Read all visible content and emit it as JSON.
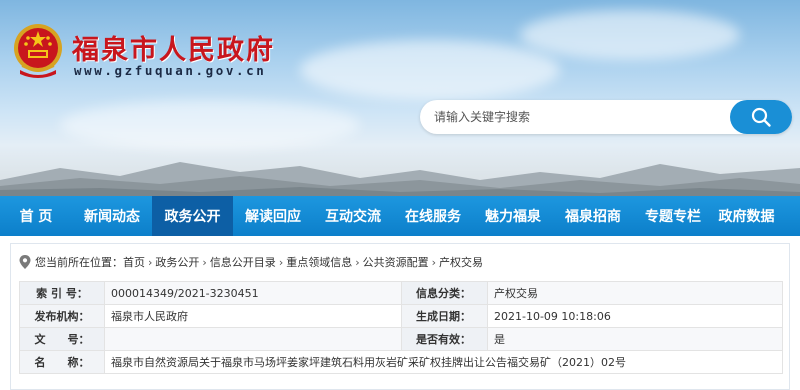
{
  "site": {
    "title": "福泉市人民政府",
    "url": "www.gzfuquan.gov.cn"
  },
  "search": {
    "placeholder": "请输入关键字搜索",
    "button_icon": "search-icon"
  },
  "nav": {
    "items": [
      {
        "label": "首 页"
      },
      {
        "label": "新闻动态"
      },
      {
        "label": "政务公开",
        "active": true
      },
      {
        "label": "解读回应"
      },
      {
        "label": "互动交流"
      },
      {
        "label": "在线服务"
      },
      {
        "label": "魅力福泉"
      },
      {
        "label": "福泉招商"
      },
      {
        "label": "专题专栏"
      },
      {
        "label": "政府数据"
      }
    ]
  },
  "breadcrumb": {
    "prefix": "您当前所在位置：",
    "items": [
      "首页",
      "政务公开",
      "信息公开目录",
      "重点领域信息",
      "公共资源配置",
      "产权交易"
    ],
    "separator": "›"
  },
  "info": {
    "index_label": "索 引 号：",
    "index_value": "000014349/2021-3230451",
    "category_label": "信息分类：",
    "category_value": "产权交易",
    "org_label": "发布机构：",
    "org_value": "福泉市人民政府",
    "date_label": "生成日期：",
    "date_value": "2021-10-09 10:18:06",
    "docno_label": "文　　号：",
    "docno_value": "",
    "valid_label": "是否有效：",
    "valid_value": "是",
    "name_label": "名　　称：",
    "name_value": "福泉市自然资源局关于福泉市马场坪姜家坪建筑石料用灰岩矿采矿权挂牌出让公告福交易矿（2021）02号"
  },
  "colors": {
    "title_red": "#c8161d",
    "nav_blue": "#0c7fca",
    "nav_active": "#0d5fa5",
    "search_button": "#1a8fd6"
  }
}
